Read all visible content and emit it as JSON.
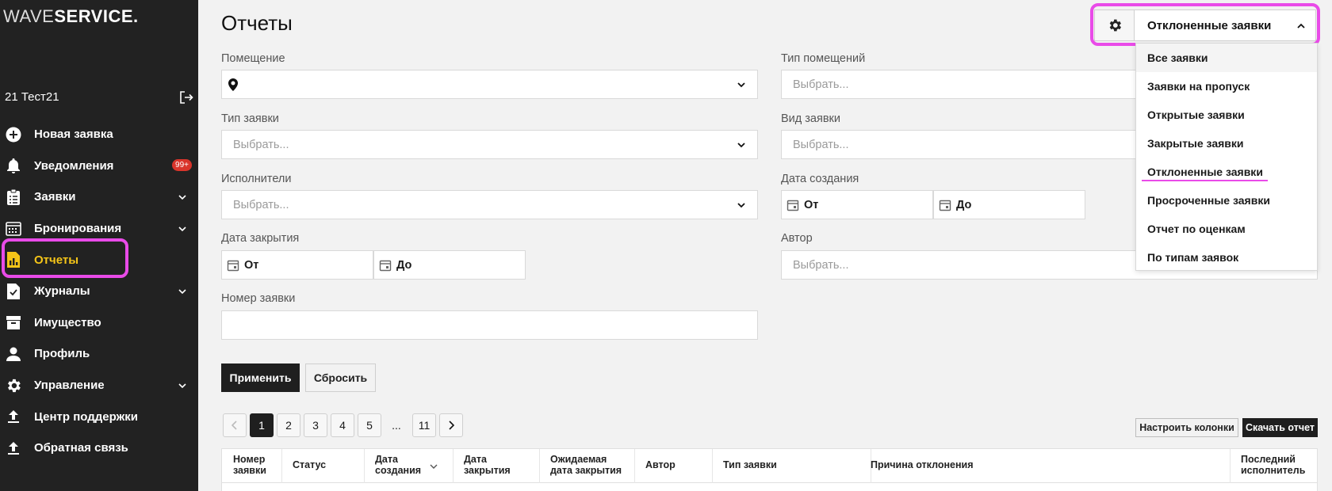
{
  "sidebar": {
    "logo": {
      "light": "WAVE",
      "bold": "SERVICE."
    },
    "user": "21 Тест21",
    "items": [
      {
        "label": "Новая заявка",
        "icon": "plus-circle-icon"
      },
      {
        "label": "Уведомления",
        "icon": "bell-icon",
        "badge": "99+"
      },
      {
        "label": "Заявки",
        "icon": "clipboard-icon"
      },
      {
        "label": "Бронирования",
        "icon": "calendar-grid-icon"
      },
      {
        "label": "Отчеты",
        "icon": "report-icon"
      },
      {
        "label": "Журналы",
        "icon": "journal-check-icon"
      },
      {
        "label": "Имущество",
        "icon": "box-icon"
      },
      {
        "label": "Профиль",
        "icon": "person-icon"
      },
      {
        "label": "Управление",
        "icon": "gear-icon"
      },
      {
        "label": "Центр поддержки",
        "icon": "upload-icon"
      },
      {
        "label": "Обратная связь",
        "icon": "upload-icon"
      }
    ]
  },
  "main": {
    "title": "Отчеты",
    "filters": {
      "room_label": "Помещение",
      "room_type_label": "Тип помещений",
      "request_type_label": "Тип заявки",
      "request_kind_label": "Вид заявки",
      "executors_label": "Исполнители",
      "created_label": "Дата создания",
      "closed_label": "Дата закрытия",
      "author_label": "Автор",
      "number_label": "Номер заявки",
      "placeholder": "Выбрать...",
      "from": "От",
      "to": "До"
    },
    "apply": "Применить",
    "reset": "Сбросить",
    "pagination": [
      "1",
      "2",
      "3",
      "4",
      "5",
      "...",
      "11"
    ],
    "configure_columns": "Настроить колонки",
    "download": "Скачать отчет",
    "columns": [
      {
        "line1": "Номер",
        "line2": "заявки"
      },
      {
        "line1": "Статус",
        "line2": ""
      },
      {
        "line1": "Дата",
        "line2": "создания"
      },
      {
        "line1": "Дата",
        "line2": "закрытия"
      },
      {
        "line1": "Ожидаемая",
        "line2": "дата закрытия"
      },
      {
        "line1": "Автор",
        "line2": ""
      },
      {
        "line1": "Тип заявки",
        "line2": ""
      },
      {
        "line1": "Причина отклонения",
        "line2": ""
      },
      {
        "line1": "Последний",
        "line2": "исполнитель"
      }
    ]
  },
  "report_select": {
    "value": "Отклоненные заявки",
    "options": [
      "Все заявки",
      "Заявки на пропуск",
      "Открытые заявки",
      "Закрытые заявки",
      "Отклоненные заявки",
      "Просроченные заявки",
      "Отчет по оценкам",
      "По типам заявок"
    ]
  },
  "colors": {
    "highlight": "#e94be8",
    "active_nav": "#f5c518",
    "badge": "#d9352b",
    "sidebar_bg": "#222222"
  }
}
